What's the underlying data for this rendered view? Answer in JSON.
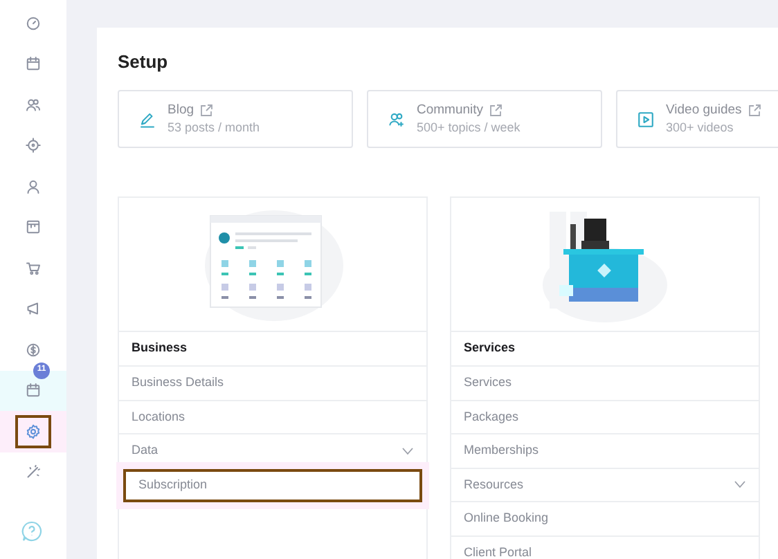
{
  "sidebar": {
    "items": [
      {
        "selected": false,
        "highlighted": false,
        "outlined": false
      },
      {
        "selected": false,
        "highlighted": false,
        "outlined": false
      },
      {
        "selected": false,
        "highlighted": false,
        "outlined": false
      },
      {
        "selected": false,
        "highlighted": false,
        "outlined": false
      },
      {
        "selected": false,
        "highlighted": false,
        "outlined": false
      },
      {
        "selected": false,
        "highlighted": false,
        "outlined": false
      },
      {
        "selected": false,
        "highlighted": false,
        "outlined": false
      },
      {
        "selected": false,
        "highlighted": false,
        "outlined": false
      },
      {
        "selected": false,
        "highlighted": false,
        "outlined": false
      },
      {
        "selected": false,
        "highlighted": true,
        "outlined": false,
        "badge": "11"
      },
      {
        "selected": true,
        "outlined": true
      },
      {
        "selected": false,
        "highlighted": false,
        "outlined": false
      }
    ]
  },
  "page": {
    "title": "Setup",
    "resources": [
      {
        "title": "Blog",
        "subtitle": "53 posts / month"
      },
      {
        "title": "Community",
        "subtitle": "500+ topics / week"
      },
      {
        "title": "Video guides",
        "subtitle": "300+ videos"
      }
    ],
    "sections": [
      {
        "title": "Business",
        "rows": [
          {
            "label": "Business Details",
            "kind": "link",
            "outlined": false
          },
          {
            "label": "Locations",
            "kind": "link",
            "outlined": false
          },
          {
            "label": "Data",
            "kind": "expandable",
            "outlined": false
          },
          {
            "label": "Subscription",
            "kind": "link",
            "outlined": true
          }
        ]
      },
      {
        "title": "Services",
        "rows": [
          {
            "label": "Services",
            "kind": "link",
            "outlined": false
          },
          {
            "label": "Packages",
            "kind": "link",
            "outlined": false
          },
          {
            "label": "Memberships",
            "kind": "link",
            "outlined": false
          },
          {
            "label": "Resources",
            "kind": "expandable",
            "outlined": false
          },
          {
            "label": "Online Booking",
            "kind": "link",
            "outlined": false
          },
          {
            "label": "Client Portal",
            "kind": "link",
            "outlined": false
          }
        ]
      }
    ]
  }
}
